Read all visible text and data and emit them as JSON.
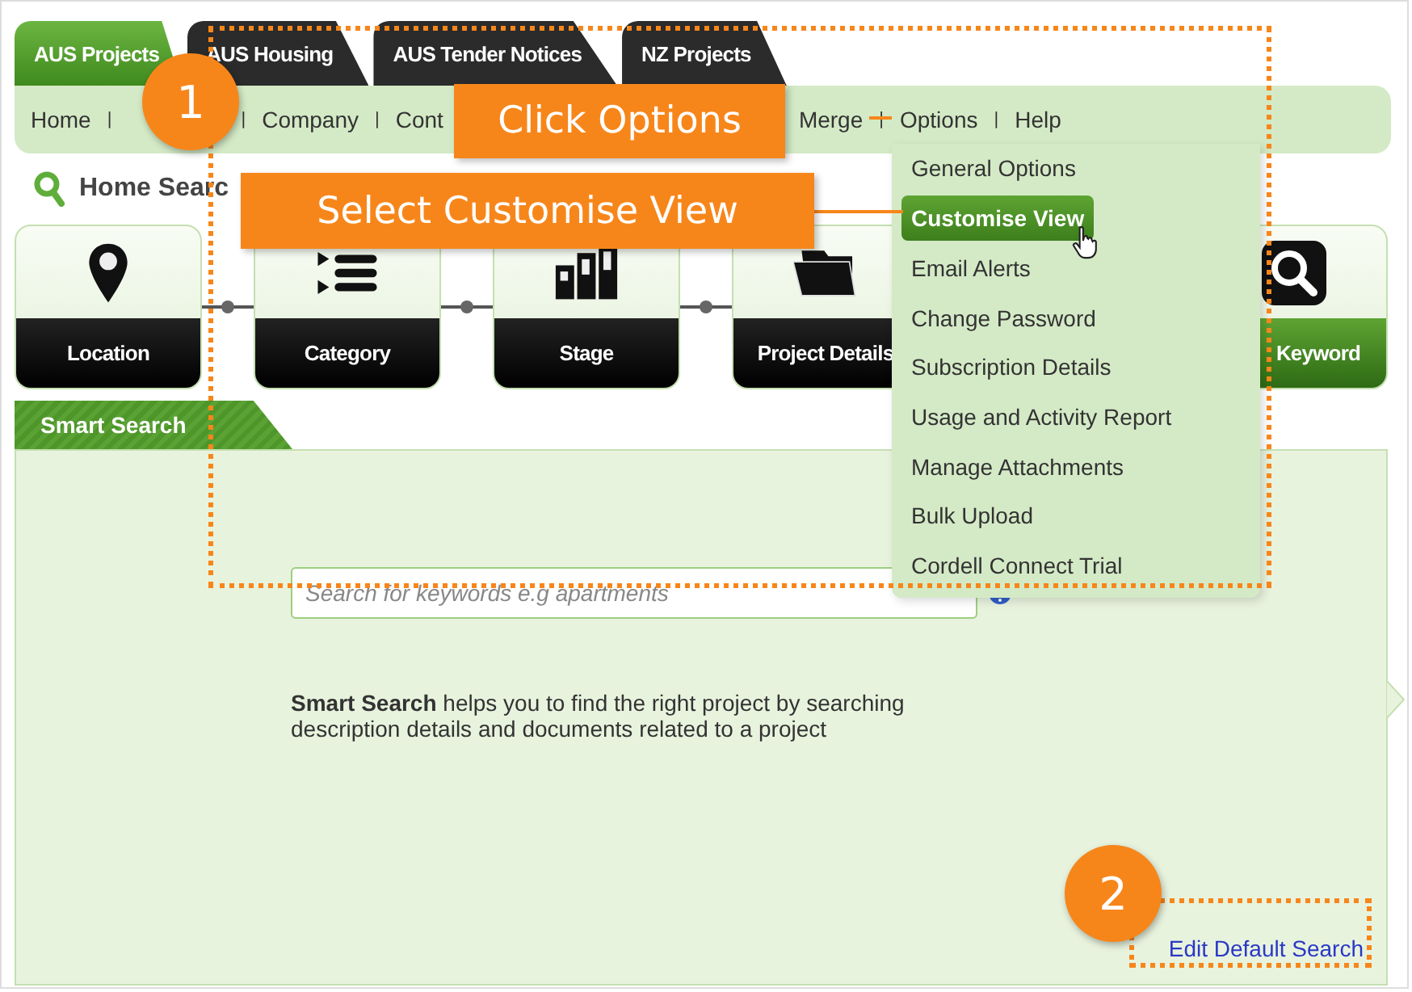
{
  "tabs": [
    {
      "label": "AUS Projects",
      "selected": true
    },
    {
      "label": "AUS Housing",
      "selected": false
    },
    {
      "label": "AUS Tender Notices",
      "selected": false
    },
    {
      "label": "NZ Projects",
      "selected": false
    }
  ],
  "nav": [
    {
      "kind": "link",
      "label": "Home"
    },
    {
      "kind": "separator",
      "label": "|"
    },
    {
      "kind": "separator",
      "label": "|"
    },
    {
      "kind": "link",
      "label": "Company"
    },
    {
      "kind": "separator",
      "label": "|"
    },
    {
      "kind": "link",
      "label": "Cont"
    },
    {
      "kind": "link",
      "label": "Merge"
    },
    {
      "kind": "separator",
      "label": "|"
    },
    {
      "kind": "link",
      "label": "Options"
    },
    {
      "kind": "separator",
      "label": "|"
    },
    {
      "kind": "link",
      "label": "Help"
    }
  ],
  "options_menu": [
    {
      "label": "General Options",
      "selected": false
    },
    {
      "label": "Customise View",
      "selected": true
    },
    {
      "label": "Email Alerts",
      "selected": false
    },
    {
      "label": "Change Password",
      "selected": false
    },
    {
      "label": "Subscription Details",
      "selected": false
    },
    {
      "label": "Usage and Activity Report",
      "selected": false
    },
    {
      "label": "Manage Attachments",
      "selected": false
    },
    {
      "label": "Bulk Upload",
      "selected": false
    },
    {
      "label": "Cordell Connect Trial",
      "selected": false
    }
  ],
  "heading": "Home Searc",
  "steps": [
    {
      "kind": "location",
      "label": "Location",
      "selected": false
    },
    {
      "kind": "category",
      "label": "Category",
      "selected": false
    },
    {
      "kind": "stage",
      "label": "Stage",
      "selected": false
    },
    {
      "kind": "details",
      "label": "Project Details",
      "selected": false
    },
    {
      "kind": "keyword",
      "label": "Keyword",
      "selected": true
    }
  ],
  "smart_search": {
    "tab": "Smart Search",
    "placeholder": "Search for keywords e.g apartments",
    "description": "**Smart Search** helps you to find the right project by searching description details and documents related to a project",
    "link": "Edit Default Search"
  },
  "annotations": {
    "steps": [
      {
        "number": "1"
      },
      {
        "number": "2"
      }
    ],
    "callouts": [
      {
        "text": "Click Options"
      },
      {
        "text": "Select Customise View"
      }
    ]
  }
}
